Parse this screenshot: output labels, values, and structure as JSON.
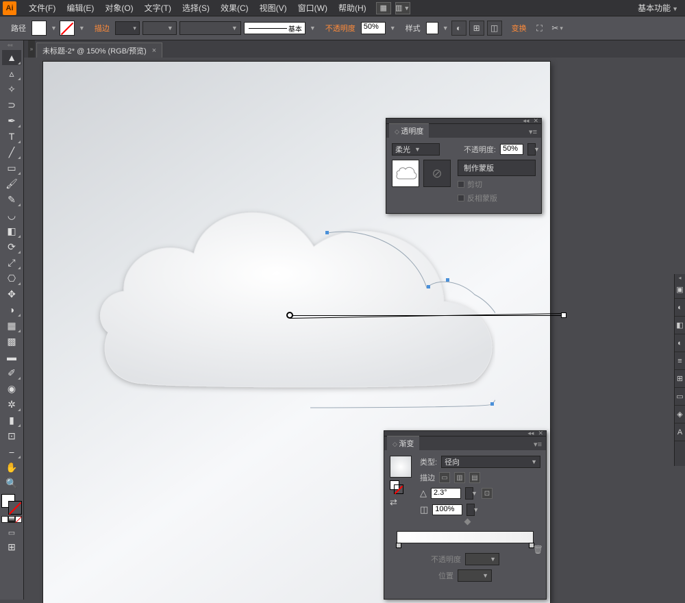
{
  "app_logo": "Ai",
  "menu": [
    "文件(F)",
    "编辑(E)",
    "对象(O)",
    "文字(T)",
    "选择(S)",
    "效果(C)",
    "视图(V)",
    "窗口(W)",
    "帮助(H)"
  ],
  "workspace": "基本功能",
  "control": {
    "selection_label": "路径",
    "stroke_label": "描边",
    "stroke_weight": "",
    "profile_label": "基本",
    "opacity_label": "不透明度",
    "opacity_value": "50%",
    "style_label": "样式",
    "transform_label": "变换"
  },
  "tab": {
    "title": "未标题-2* @ 150% (RGB/预览)"
  },
  "tools": [
    "selection",
    "direct",
    "wand",
    "lasso",
    "pen",
    "type",
    "line",
    "rect",
    "brush",
    "pencil",
    "blob",
    "eraser",
    "rotate",
    "scale",
    "width",
    "freetransform",
    "shapebuilder",
    "perspective",
    "mesh",
    "gradient",
    "eyedrop",
    "blend",
    "symbol",
    "graph",
    "artboard",
    "slice",
    "hand",
    "zoom"
  ],
  "transparency_panel": {
    "title": "透明度",
    "blend_mode": "柔光",
    "opacity_label": "不透明度:",
    "opacity_value": "50%",
    "make_mask": "制作蒙版",
    "clip": "剪切",
    "invert": "反相蒙版"
  },
  "gradient_panel": {
    "title": "渐变",
    "type_label": "类型:",
    "type_value": "径向",
    "stroke_label": "描边",
    "angle_value": "2.3°",
    "aspect_value": "100%",
    "opacity_label": "不透明度",
    "location_label": "位置"
  }
}
